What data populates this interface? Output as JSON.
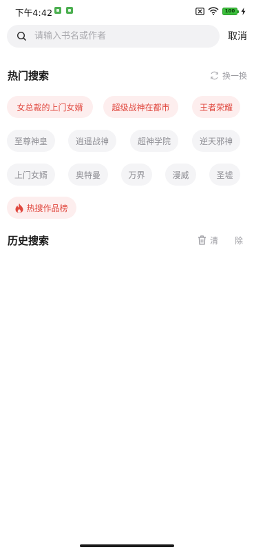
{
  "status_bar": {
    "time": "下午4:42",
    "battery_level": "100"
  },
  "search": {
    "placeholder": "请输入书名或作者",
    "value": "",
    "cancel_label": "取消"
  },
  "hot_search": {
    "title": "热门搜索",
    "refresh_label": "换一换",
    "tags": [
      {
        "label": "女总裁的上门女婿",
        "style": "hot"
      },
      {
        "label": "超级战神在都市",
        "style": "hot"
      },
      {
        "label": "王者荣耀",
        "style": "hot"
      },
      {
        "label": "至尊神皇",
        "style": "normal"
      },
      {
        "label": "逍遥战神",
        "style": "normal"
      },
      {
        "label": "超神学院",
        "style": "normal"
      },
      {
        "label": "逆天邪神",
        "style": "normal"
      },
      {
        "label": "上门女婿",
        "style": "normal"
      },
      {
        "label": "奥特曼",
        "style": "normal"
      },
      {
        "label": "万界",
        "style": "normal"
      },
      {
        "label": "漫威",
        "style": "normal"
      },
      {
        "label": "圣墟",
        "style": "normal"
      }
    ],
    "board_label": "热搜作品榜"
  },
  "history": {
    "title": "历史搜索",
    "clear_label": "清　除"
  },
  "colors": {
    "hot_text": "#e0473e",
    "hot_bg": "#fdeeee",
    "normal_text": "#8f8f95",
    "normal_bg": "#f4f4f6"
  }
}
